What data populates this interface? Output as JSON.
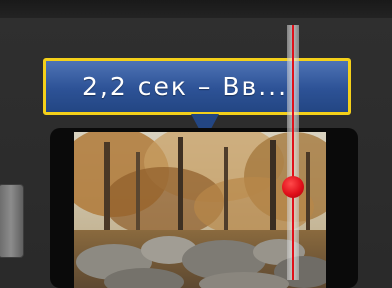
{
  "tooltip": {
    "text": "2,2 сек – Вв..."
  },
  "colors": {
    "tooltip_bg": "#2d5296",
    "tooltip_border": "#f4d01a",
    "playhead": "#e0101a",
    "background": "#2b2b2b"
  },
  "icons": {
    "playhead_knob": "red-circle",
    "clip_thumbnail": "autumn-forest-rocks"
  }
}
